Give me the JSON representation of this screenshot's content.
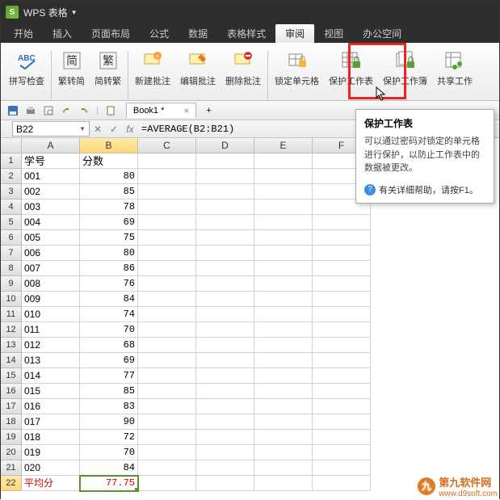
{
  "app": {
    "logo_letter": "S",
    "title": "WPS 表格"
  },
  "menu": {
    "items": [
      "开始",
      "插入",
      "页面布局",
      "公式",
      "数据",
      "表格样式",
      "审阅",
      "视图",
      "办公空间"
    ],
    "active_index": 6
  },
  "ribbon": {
    "buttons": [
      {
        "label": "拼写检查",
        "icon": "abc"
      },
      {
        "label": "繁转简",
        "icon": "t2s"
      },
      {
        "label": "简转繁",
        "icon": "s2t"
      },
      {
        "label": "新建批注",
        "icon": "new-comment"
      },
      {
        "label": "编辑批注",
        "icon": "edit-comment"
      },
      {
        "label": "删除批注",
        "icon": "del-comment"
      },
      {
        "label": "锁定单元格",
        "icon": "lock-cell"
      },
      {
        "label": "保护工作表",
        "icon": "protect-sheet"
      },
      {
        "label": "保护工作簿",
        "icon": "protect-book"
      },
      {
        "label": "共享工作",
        "icon": "share"
      }
    ],
    "separators_after": [
      0,
      2,
      5
    ]
  },
  "qat": {
    "doc_tab": "Book1 *"
  },
  "formula_bar": {
    "name_box": "B22",
    "formula": "=AVERAGE(B2:B21)"
  },
  "tooltip": {
    "title": "保护工作表",
    "body": "可以通过密码对锁定的单元格进行保护，以防止工作表中的数据被更改。",
    "help": "有关详细帮助，请按F1。"
  },
  "sheet": {
    "columns": [
      "A",
      "B",
      "C",
      "D",
      "E",
      "F"
    ],
    "selected_col_index": 1,
    "selected_row_index": 21,
    "headers": {
      "A": "学号",
      "B": "分数"
    },
    "rows": [
      {
        "A": "001",
        "B": 80
      },
      {
        "A": "002",
        "B": 85
      },
      {
        "A": "003",
        "B": 78
      },
      {
        "A": "004",
        "B": 69
      },
      {
        "A": "005",
        "B": 75
      },
      {
        "A": "006",
        "B": 80
      },
      {
        "A": "007",
        "B": 86
      },
      {
        "A": "008",
        "B": 76
      },
      {
        "A": "009",
        "B": 84
      },
      {
        "A": "010",
        "B": 74
      },
      {
        "A": "011",
        "B": 70
      },
      {
        "A": "012",
        "B": 68
      },
      {
        "A": "013",
        "B": 69
      },
      {
        "A": "014",
        "B": 77
      },
      {
        "A": "015",
        "B": 85
      },
      {
        "A": "016",
        "B": 83
      },
      {
        "A": "017",
        "B": 90
      },
      {
        "A": "018",
        "B": 72
      },
      {
        "A": "019",
        "B": 70
      },
      {
        "A": "020",
        "B": 84
      }
    ],
    "footer": {
      "A": "平均分",
      "B": "77.75"
    }
  },
  "watermark": {
    "text": "第九软件网",
    "url": "www.d9soft.com"
  }
}
